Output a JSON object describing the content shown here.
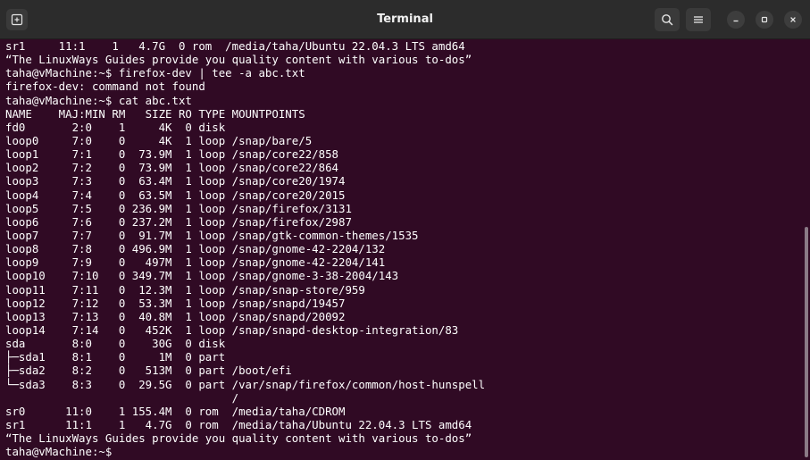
{
  "window": {
    "title": "Terminal"
  },
  "icons": {
    "new_tab": "new-tab-icon",
    "search": "search-icon",
    "menu": "hamburger-menu-icon",
    "minimize": "minimize-icon",
    "maximize": "maximize-icon",
    "close": "close-icon"
  },
  "colors": {
    "terminal_bg": "#300a24",
    "titlebar_bg": "#2c2c2c",
    "text": "#ffffff"
  },
  "terminal": {
    "lines": [
      "sr1     11:1    1   4.7G  0 rom  /media/taha/Ubuntu 22.04.3 LTS amd64",
      "“The LinuxWays Guides provide you quality content with various to-dos”",
      "taha@vMachine:~$ firefox-dev | tee -a abc.txt",
      "firefox-dev: command not found",
      "taha@vMachine:~$ cat abc.txt",
      "NAME    MAJ:MIN RM   SIZE RO TYPE MOUNTPOINTS",
      "fd0       2:0    1     4K  0 disk",
      "loop0     7:0    0     4K  1 loop /snap/bare/5",
      "loop1     7:1    0  73.9M  1 loop /snap/core22/858",
      "loop2     7:2    0  73.9M  1 loop /snap/core22/864",
      "loop3     7:3    0  63.4M  1 loop /snap/core20/1974",
      "loop4     7:4    0  63.5M  1 loop /snap/core20/2015",
      "loop5     7:5    0 236.9M  1 loop /snap/firefox/3131",
      "loop6     7:6    0 237.2M  1 loop /snap/firefox/2987",
      "loop7     7:7    0  91.7M  1 loop /snap/gtk-common-themes/1535",
      "loop8     7:8    0 496.9M  1 loop /snap/gnome-42-2204/132",
      "loop9     7:9    0   497M  1 loop /snap/gnome-42-2204/141",
      "loop10    7:10   0 349.7M  1 loop /snap/gnome-3-38-2004/143",
      "loop11    7:11   0  12.3M  1 loop /snap/snap-store/959",
      "loop12    7:12   0  53.3M  1 loop /snap/snapd/19457",
      "loop13    7:13   0  40.8M  1 loop /snap/snapd/20092",
      "loop14    7:14   0   452K  1 loop /snap/snapd-desktop-integration/83",
      "sda       8:0    0    30G  0 disk",
      "├─sda1    8:1    0     1M  0 part",
      "├─sda2    8:2    0   513M  0 part /boot/efi",
      "└─sda3    8:3    0  29.5G  0 part /var/snap/firefox/common/host-hunspell",
      "                                  /",
      "sr0      11:0    1 155.4M  0 rom  /media/taha/CDROM",
      "sr1      11:1    1   4.7G  0 rom  /media/taha/Ubuntu 22.04.3 LTS amd64",
      "“The LinuxWays Guides provide you quality content with various to-dos”",
      "taha@vMachine:~$ "
    ]
  }
}
